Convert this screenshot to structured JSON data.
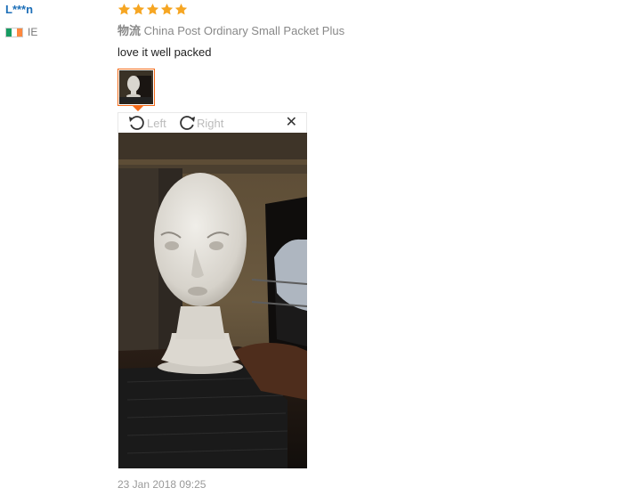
{
  "reviewer": {
    "name": "L***n",
    "country_code": "IE",
    "flag_colors": [
      "#169b62",
      "#ffffff",
      "#ff883e"
    ]
  },
  "review": {
    "rating": 5,
    "max_rating": 5,
    "star_color": "#f6a623",
    "logistics_label": "物流",
    "logistics_value": "China Post Ordinary Small Packet Plus",
    "text": "love it well packed",
    "date": "23 Jan 2018 09:25"
  },
  "viewer": {
    "rotate_left_label": "Left",
    "rotate_right_label": "Right",
    "close_icon": "close-icon",
    "accent_color": "#f56b1a"
  }
}
